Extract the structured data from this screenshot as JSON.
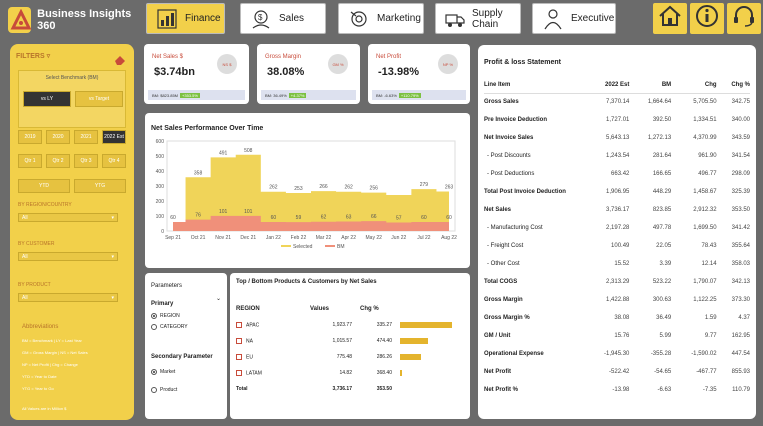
{
  "app": {
    "title": "Business Insights 360"
  },
  "nav": [
    {
      "label": "Finance",
      "icon": "finance-icon",
      "active": true
    },
    {
      "label": "Sales",
      "icon": "sales-icon",
      "active": false
    },
    {
      "label": "Marketing",
      "icon": "marketing-icon",
      "active": false
    },
    {
      "label": "Supply Chain",
      "icon": "supply-chain-icon",
      "active": false
    },
    {
      "label": "Executive",
      "icon": "executive-icon",
      "active": false
    }
  ],
  "filters": {
    "title": "FILTERS",
    "benchmark_title": "Select Benchmark (BM)",
    "benchmark_options": [
      "vs LY",
      "vs Target"
    ],
    "years": [
      "2019",
      "2020",
      "2021",
      "2022 Est"
    ],
    "quarters": [
      "Qtr 1",
      "Qtr 2",
      "Qtr 3",
      "Qtr 4"
    ],
    "ytd": [
      "YTD",
      "YTG"
    ],
    "region_label": "BY REGION/COUNTRY",
    "region_value": "All",
    "customer_label": "BY CUSTOMER",
    "customer_value": "All",
    "product_label": "BY PRODUCT",
    "product_value": "All",
    "abbr_title": "Abbreviations",
    "abbreviations": [
      "BM = Benchmark | LY = Last Year",
      "GM = Gross Margin | NS = Net Sales",
      "NP = Net Profit | Chg = Change",
      "YTD = Year to Date",
      "YTG = Year to Go"
    ],
    "footnote": "All Values are in Million $"
  },
  "kpis": [
    {
      "title": "Net Sales $",
      "value": "$3.74bn",
      "badge": "NS $",
      "bm": "BM: $823.85M",
      "chg": "+353.5%"
    },
    {
      "title": "Gross Margin",
      "value": "38.08%",
      "badge": "GM %",
      "bm": "BM: 36.49%",
      "chg": "+4.37%"
    },
    {
      "title": "Net Profit",
      "value": "-13.98%",
      "badge": "NP %",
      "bm": "BM: -6.63%",
      "chg": "+110.79%"
    }
  ],
  "chart_data": {
    "type": "area",
    "title": "Net Sales Performance Over Time",
    "categories": [
      "Sep 21",
      "Oct 21",
      "Nov 21",
      "Dec 21",
      "Jan 22",
      "Feb 22",
      "Mar 22",
      "Apr 22",
      "May 22",
      "Jun 22",
      "Jul 22",
      "Aug 22"
    ],
    "ylim": [
      0,
      600
    ],
    "yticks": [
      0,
      100,
      200,
      300,
      400,
      500,
      600
    ],
    "series": [
      {
        "name": "Selected",
        "color": "#f0d459",
        "values": [
          60,
          358,
          491,
          508,
          262,
          253,
          266,
          262,
          256,
          240,
          279,
          263
        ]
      },
      {
        "name": "BM",
        "color": "#f0907a",
        "values": [
          60,
          76,
          101,
          101,
          60,
          59,
          62,
          63,
          66,
          57,
          60,
          60
        ]
      }
    ],
    "data_labels": {
      "Selected": [
        "",
        "358",
        "491",
        "508",
        "262",
        "253",
        "266",
        "262",
        "256",
        "",
        "279",
        "263"
      ],
      "BM": [
        "60",
        "76",
        "101",
        "101",
        "60",
        "59",
        "62",
        "63",
        "66",
        "57",
        "60",
        "60"
      ]
    },
    "legend": "bottom"
  },
  "parameters": {
    "title": "Parameters",
    "primary_label": "Primary",
    "primary_options": [
      "REGION",
      "CATEGORY"
    ],
    "primary_selected": "REGION",
    "secondary_label": "Secondary Parameter",
    "secondary_options": [
      "Market",
      "Product"
    ],
    "secondary_selected": "Market"
  },
  "top_bottom": {
    "title": "Top / Bottom Products & Customers by Net Sales",
    "columns": [
      "REGION",
      "Values",
      "Chg %"
    ],
    "rows": [
      {
        "region": "APAC",
        "values": "1,923.77",
        "chg": "335.27",
        "share": 1.0
      },
      {
        "region": "NA",
        "values": "1,015.57",
        "chg": "474.40",
        "share": 0.53
      },
      {
        "region": "EU",
        "values": "775.48",
        "chg": "286.26",
        "share": 0.4
      },
      {
        "region": "LATAM",
        "values": "14.82",
        "chg": "368.40",
        "share": 0.01
      }
    ],
    "total": {
      "label": "Total",
      "values": "3,736.17",
      "chg": "353.50"
    }
  },
  "pl": {
    "title": "Profit & loss Statement",
    "columns": [
      "Line Item",
      "2022 Est",
      "BM",
      "Chg",
      "Chg %"
    ],
    "rows": [
      {
        "item": "Gross Sales",
        "est": "7,370.14",
        "bm": "1,664.64",
        "chg": "5,705.50",
        "pct": "342.75",
        "sub": false
      },
      {
        "item": "Pre Invoice Deduction",
        "est": "1,727.01",
        "bm": "392.50",
        "chg": "1,334.51",
        "pct": "340.00",
        "sub": false
      },
      {
        "item": "Net Invoice Sales",
        "est": "5,643.13",
        "bm": "1,272.13",
        "chg": "4,370.99",
        "pct": "343.59",
        "sub": false
      },
      {
        "item": "- Post Discounts",
        "est": "1,243.54",
        "bm": "281.64",
        "chg": "961.90",
        "pct": "341.54",
        "sub": true
      },
      {
        "item": "- Post Deductions",
        "est": "663.42",
        "bm": "166.65",
        "chg": "496.77",
        "pct": "298.09",
        "sub": true
      },
      {
        "item": "Total Post Invoice Deduction",
        "est": "1,906.95",
        "bm": "448.29",
        "chg": "1,458.67",
        "pct": "325.39",
        "sub": false
      },
      {
        "item": "Net Sales",
        "est": "3,736.17",
        "bm": "823.85",
        "chg": "2,912.32",
        "pct": "353.50",
        "sub": false
      },
      {
        "item": "- Manufacturing Cost",
        "est": "2,197.28",
        "bm": "497.78",
        "chg": "1,699.50",
        "pct": "341.42",
        "sub": true
      },
      {
        "item": "- Freight Cost",
        "est": "100.49",
        "bm": "22.05",
        "chg": "78.43",
        "pct": "355.64",
        "sub": true
      },
      {
        "item": "- Other Cost",
        "est": "15.52",
        "bm": "3.39",
        "chg": "12.14",
        "pct": "358.03",
        "sub": true
      },
      {
        "item": "Total COGS",
        "est": "2,313.29",
        "bm": "523.22",
        "chg": "1,790.07",
        "pct": "342.13",
        "sub": false
      },
      {
        "item": "Gross Margin",
        "est": "1,422.88",
        "bm": "300.63",
        "chg": "1,122.25",
        "pct": "373.30",
        "sub": false
      },
      {
        "item": "Gross Margin %",
        "est": "38.08",
        "bm": "36.49",
        "chg": "1.59",
        "pct": "4.37",
        "sub": false
      },
      {
        "item": "GM / Unit",
        "est": "15.76",
        "bm": "5.99",
        "chg": "9.77",
        "pct": "162.95",
        "sub": false
      },
      {
        "item": "Operational Expense",
        "est": "-1,945.30",
        "bm": "-355.28",
        "chg": "-1,590.02",
        "pct": "447.54",
        "sub": false
      },
      {
        "item": "Net Profit",
        "est": "-522.42",
        "bm": "-54.65",
        "chg": "-467.77",
        "pct": "855.93",
        "sub": false
      },
      {
        "item": "Net Profit %",
        "est": "-13.98",
        "bm": "-6.63",
        "chg": "-7.35",
        "pct": "110.79",
        "sub": false
      }
    ]
  }
}
